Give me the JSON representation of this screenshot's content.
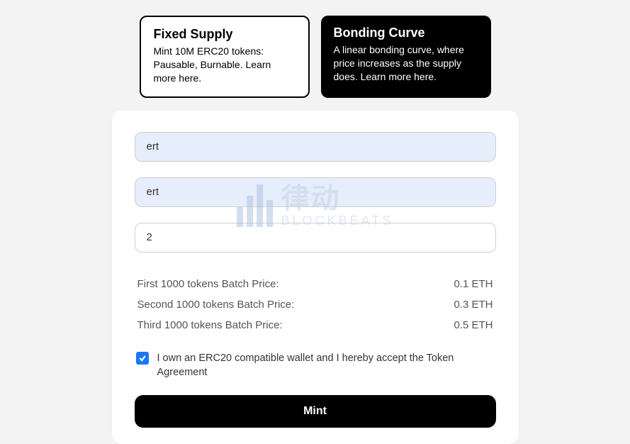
{
  "options": {
    "fixed": {
      "title": "Fixed Supply",
      "desc": "Mint 10M ERC20 tokens: Pausable, Burnable. Learn more here."
    },
    "bonding": {
      "title": "Bonding Curve",
      "desc": "A linear bonding curve, where price increases as the supply does. Learn more here."
    }
  },
  "form": {
    "input1": "ert",
    "input2": "ert",
    "input3": "2"
  },
  "prices": {
    "first_label": "First 1000 tokens Batch Price:",
    "first_value": "0.1 ETH",
    "second_label": "Second 1000 tokens Batch Price:",
    "second_value": "0.3 ETH",
    "third_label": "Third 1000 tokens Batch Price:",
    "third_value": "0.5 ETH"
  },
  "agreement": {
    "text": "I own an ERC20 compatible wallet and I hereby accept the Token Agreement"
  },
  "buttons": {
    "mint": "Mint"
  },
  "watermark": {
    "cn": "律动",
    "en": "BLOCKBEATS"
  }
}
